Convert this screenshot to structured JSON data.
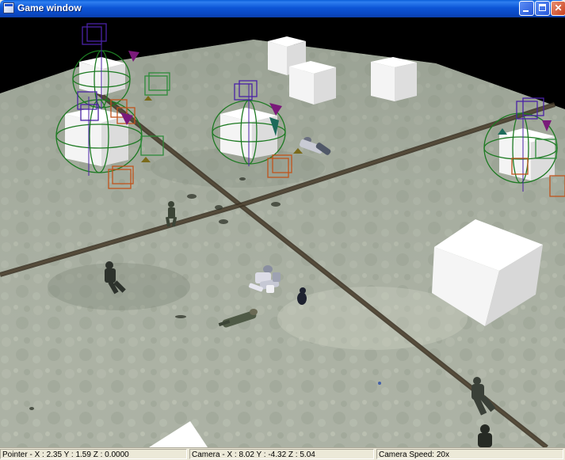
{
  "window": {
    "title": "Game window",
    "icon": "application-icon",
    "controls": [
      "minimize-icon",
      "maximize-icon",
      "close-icon"
    ]
  },
  "scene": {
    "sky_color": "#000000",
    "ground_color": "#a7aea0",
    "road_color": "#3c3224",
    "gizmo_colors": {
      "rotation_ring": "#1d7a22",
      "bounding_box_top": "#4a22a6",
      "bounding_box_bottom": "#c0541c",
      "bounding_box_side": "#2e8a3a",
      "marker": "#7a1a7a"
    }
  },
  "status": {
    "pointer": "Pointer - X : 2.35  Y : 1.59  Z : 0.0000",
    "camera": "Camera - X : 8.02  Y : -4.32  Z : 5.04",
    "speed": "Camera Speed: 20x"
  }
}
